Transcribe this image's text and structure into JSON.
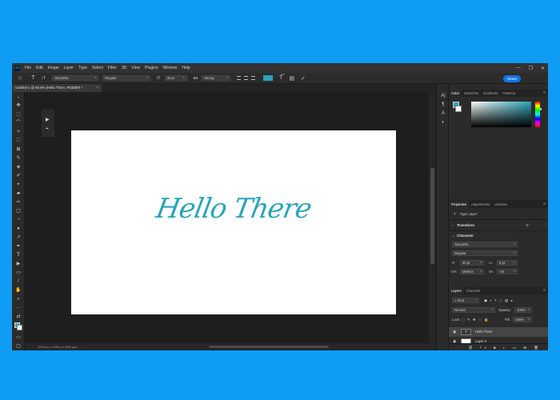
{
  "menubar": {
    "logo": "Ps",
    "items": [
      "File",
      "Edit",
      "Image",
      "Layer",
      "Type",
      "Select",
      "Filter",
      "3D",
      "View",
      "Plugins",
      "Window",
      "Help"
    ],
    "window_controls": [
      "—",
      "❐",
      "✕"
    ]
  },
  "options": {
    "home_icon": "⌂",
    "type_icon": "T",
    "orient_icon": "↕T",
    "font_family": "Storytella",
    "font_style": "Regular",
    "size_icon": "tT",
    "font_size": "30 pt",
    "aa_icon": "aa",
    "antialias": "Strong",
    "warp_icon": "T͡",
    "panels_icon": "▤",
    "confirm_icon": "✓",
    "share_label": "Share",
    "text_color": "#2aa4b8"
  },
  "tab": {
    "title": "Untitled-1 @ 60.6% (Hello There, RGB/8#) *",
    "close": "×"
  },
  "tools": [
    "✥",
    "⬚",
    "⌒",
    "✧",
    "⛶",
    "⊠",
    "✎",
    "◈",
    "✐",
    "⌖",
    "▰",
    "✑",
    "▢",
    "◔",
    "●",
    "↗",
    "✒",
    "T",
    "▶",
    "▭",
    "⁄",
    "✋",
    "⌕",
    "···",
    "⇄"
  ],
  "mini_panel": {
    "play": "▶",
    "lock": "▪▪"
  },
  "document": {
    "text": "Hello There",
    "text_color": "#2aa4b8"
  },
  "status": {
    "text": "1920 px x 1080 px (300 ppi)",
    "arrow": "›"
  },
  "side_icons": [
    "A|",
    "¶",
    "A",
    "◐",
    "⬚"
  ],
  "color_panel": {
    "tabs": [
      "Color",
      "Swatches",
      "Gradients",
      "Patterns"
    ],
    "menu": "≡",
    "foreground": "#2aa4b8",
    "background": "#ffffff"
  },
  "properties": {
    "tabs": [
      "Properties",
      "Adjustments",
      "Libraries"
    ],
    "menu": "≡",
    "kind_icon": "T",
    "kind": "Type Layer",
    "transform_label": "Transform",
    "transform_chevron": "›",
    "reset_icon": "↺",
    "character_label": "Character",
    "character_chevron": "⌄",
    "font_family": "Storytella",
    "font_style": "Regular",
    "size_icon": "tT",
    "font_size": "30 pt",
    "leading_icon": "A↕",
    "leading": "9 pt",
    "kern_icon": "V/A",
    "kerning": "Metrics",
    "track_icon": "VA",
    "tracking": "-43"
  },
  "layers": {
    "tabs": [
      "Layers",
      "Channels"
    ],
    "menu": "≡",
    "filter_icon": "⌕",
    "kind_filter": "Kind",
    "filter_icons": "▣ ◐ T ⬚ ▤ ●",
    "blend_mode": "Normal",
    "opacity_label": "Opacity:",
    "opacity": "100%",
    "lock_label": "Lock:",
    "lock_icons": "⬚ ✎ ✥ ⬚ 🔒",
    "fill_label": "Fill:",
    "fill": "100%",
    "eye": "◉",
    "rows": [
      {
        "name": "Hello There",
        "thumb": "T"
      },
      {
        "name": "Layer 0",
        "thumb": ""
      }
    ],
    "footer": "⛓ fx ◙ ◐ ▭ ⊞ 🗑"
  }
}
